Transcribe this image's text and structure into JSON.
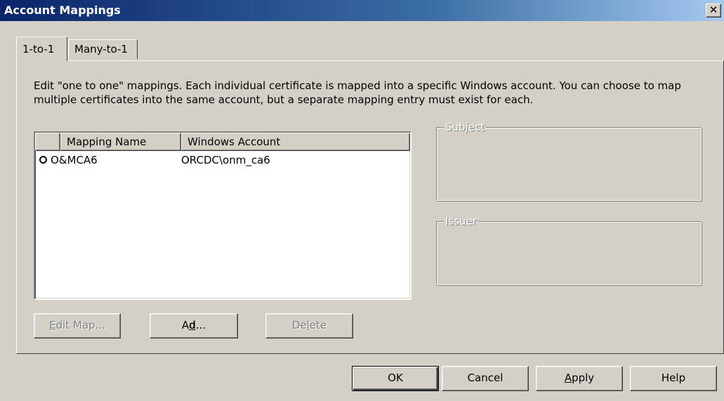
{
  "window": {
    "title": "Account Mappings",
    "close_glyph": "✕"
  },
  "tabs": [
    {
      "label": "1-to-1"
    },
    {
      "label": "Many-to-1"
    }
  ],
  "description": "Edit \"one to one\" mappings. Each individual certificate is mapped into a specific Windows account. You can choose to map multiple certificates into the same account, but a separate mapping entry must exist for each.",
  "table": {
    "columns": [
      "Mapping Name",
      "Windows Account"
    ],
    "rows": [
      {
        "mapping_name": "O&MCA6",
        "windows_account": "ORCDC\\onm_ca6",
        "icon": "circle-icon"
      }
    ]
  },
  "subject": {
    "label": "Subject"
  },
  "issuer": {
    "label": "Issuer"
  },
  "buttons": {
    "edit_map": {
      "label": "Edit Map...",
      "accel": "E",
      "rest": "dit Map..."
    },
    "add": {
      "label": "Add...",
      "pre": "A",
      "accel": "d",
      "rest": "d..."
    },
    "delete": {
      "label": "Delete",
      "pre": "De",
      "accel": "l",
      "rest": "ete"
    },
    "ok": "OK",
    "cancel": "Cancel",
    "apply": {
      "label": "Apply",
      "accel": "A",
      "rest": "pply"
    },
    "help": "Help"
  }
}
